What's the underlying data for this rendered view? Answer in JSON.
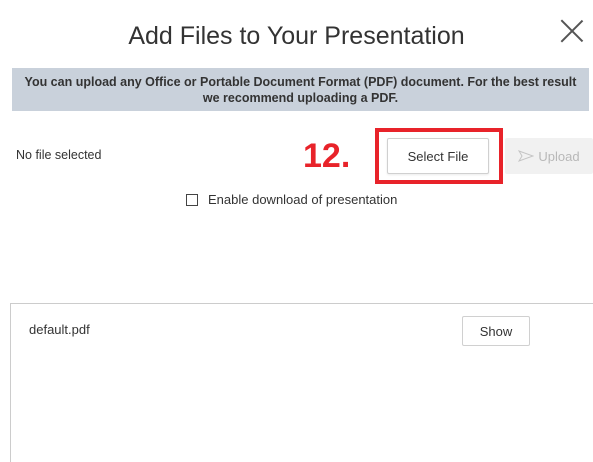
{
  "dialog": {
    "title": "Add Files to Your Presentation",
    "close_label": "×"
  },
  "banner": {
    "text": "You can upload any Office or Portable Document Format (PDF) document.  For the best result we recommend uploading a PDF."
  },
  "upload_bar": {
    "file_status": "No file selected",
    "step_annotation": "12.",
    "select_file_label": "Select File",
    "upload_label": "Upload",
    "upload_icon": "send-arrow-icon"
  },
  "options": {
    "enable_download_label": "Enable download of presentation",
    "enable_download_checked": false
  },
  "files": [
    {
      "name": "default.pdf",
      "action_label": "Show"
    }
  ],
  "colors": {
    "annotation_red": "#e8232a",
    "banner_bg": "#c9d1db",
    "disabled_button_bg": "#f1f1f1",
    "disabled_text": "#b8b8b8"
  }
}
